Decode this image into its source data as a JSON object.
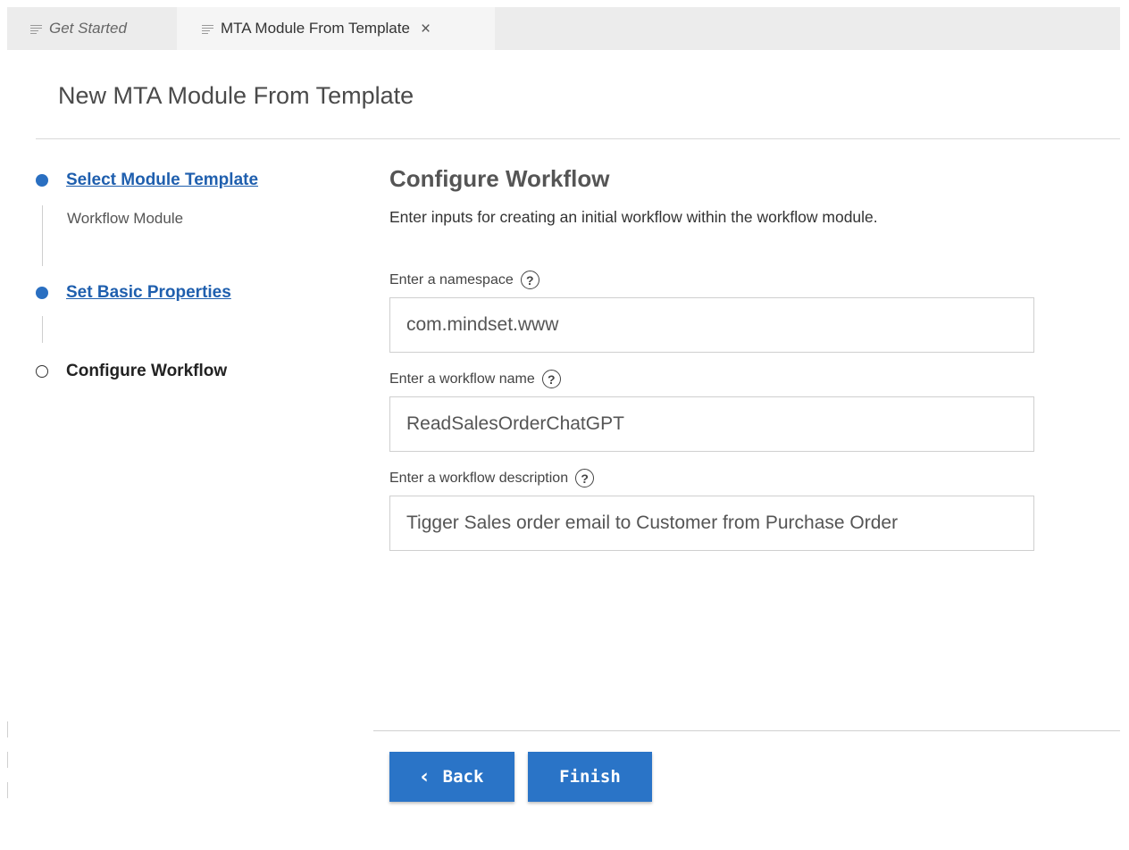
{
  "tabs": [
    {
      "label": "Get Started",
      "active": false
    },
    {
      "label": "MTA Module From Template",
      "active": true,
      "close_icon": "×"
    }
  ],
  "header": {
    "title": "New MTA Module From Template"
  },
  "steps": [
    {
      "label": "Select Module Template",
      "sublabel": "Workflow Module",
      "state": "completed"
    },
    {
      "label": "Set Basic Properties",
      "state": "completed"
    },
    {
      "label": "Configure Workflow",
      "state": "current"
    }
  ],
  "main": {
    "heading": "Configure Workflow",
    "description": "Enter inputs for creating an initial workflow within the workflow module.",
    "fields": [
      {
        "label": "Enter a namespace",
        "value": "com.mindset.www",
        "help_icon": "?"
      },
      {
        "label": "Enter a workflow name",
        "value": "ReadSalesOrderChatGPT",
        "help_icon": "?"
      },
      {
        "label": "Enter a workflow description",
        "value": "Tigger Sales order email to Customer from Purchase Order",
        "help_icon": "?"
      }
    ]
  },
  "footer": {
    "back_label": "Back",
    "back_icon": "‹",
    "finish_label": "Finish"
  },
  "colors": {
    "accent": "#2a74c7",
    "link": "#1f5fae",
    "step_done": "#2a6fc1",
    "tab_bar": "#ececec"
  },
  "icons": [
    "document-lines-icon",
    "close-icon",
    "help-icon",
    "chevron-left-icon"
  ]
}
